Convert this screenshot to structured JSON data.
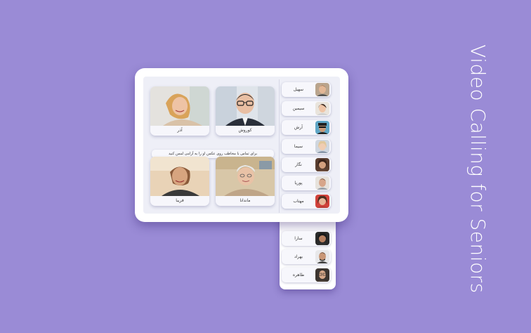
{
  "app": {
    "title": "Video Calling for Seniors"
  },
  "call": {
    "hint": "برای تماس با مخاطب روی عکس او را به آرامی لمس کنید",
    "tiles": [
      {
        "name": "کوروش",
        "icon": "man-glasses-photo"
      },
      {
        "name": "آذر",
        "icon": "woman-laughing-photo"
      },
      {
        "name": "ماندانا",
        "icon": "elderly-woman-photo"
      },
      {
        "name": "فریبا",
        "icon": "woman-beach-photo"
      }
    ]
  },
  "contacts": [
    {
      "name": "سهیل",
      "icon": "avatar-photo"
    },
    {
      "name": "سیمین",
      "icon": "avatar-photo"
    },
    {
      "name": "آرش",
      "icon": "avatar-photo"
    },
    {
      "name": "سیما",
      "icon": "avatar-photo"
    },
    {
      "name": "نگار",
      "icon": "avatar-photo"
    },
    {
      "name": "پوریا",
      "icon": "avatar-photo"
    },
    {
      "name": "مهتاب",
      "icon": "avatar-photo"
    },
    {
      "name": "سارا",
      "icon": "avatar-photo"
    },
    {
      "name": "بهراد",
      "icon": "avatar-photo"
    },
    {
      "name": "طاهره",
      "icon": "avatar-photo"
    }
  ],
  "colors": {
    "background": "#9a8bd6",
    "frame": "#ffffff",
    "screen": "#eeeff7"
  }
}
